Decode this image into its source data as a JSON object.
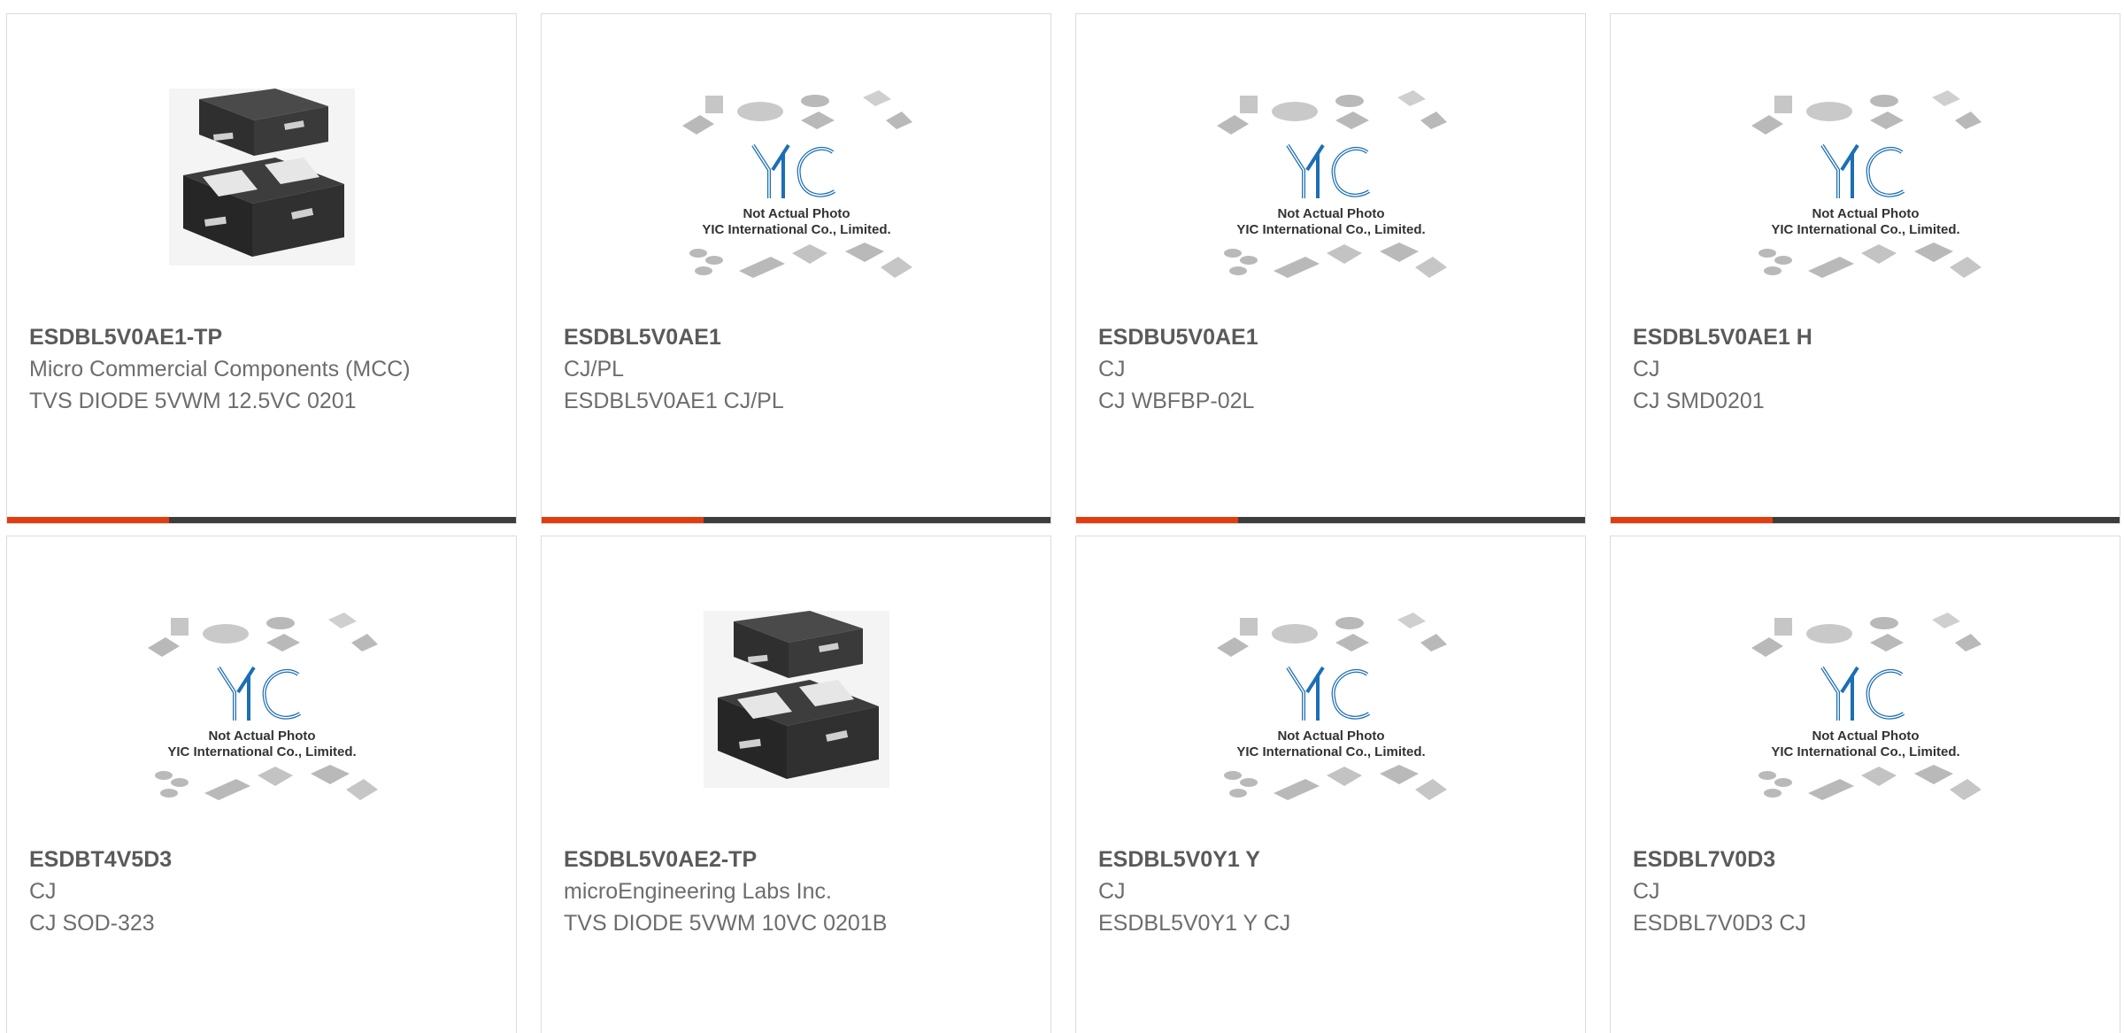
{
  "products": [
    {
      "part": "ESDBL5V0AE1-TP",
      "manufacturer": "Micro Commercial Components (MCC)",
      "description": "TVS DIODE 5VWM 12.5VC 0201",
      "image": "package-photo"
    },
    {
      "part": "ESDBL5V0AE1",
      "manufacturer": "CJ/PL",
      "description": "ESDBL5V0AE1 CJ/PL",
      "image": "yic-placeholder"
    },
    {
      "part": "ESDBU5V0AE1",
      "manufacturer": "CJ",
      "description": "CJ WBFBP-02L",
      "image": "yic-placeholder"
    },
    {
      "part": "ESDBL5V0AE1 H",
      "manufacturer": "CJ",
      "description": "CJ SMD0201",
      "image": "yic-placeholder"
    },
    {
      "part": "ESDBT4V5D3",
      "manufacturer": "CJ",
      "description": "CJ SOD-323",
      "image": "yic-placeholder"
    },
    {
      "part": "ESDBL5V0AE2-TP",
      "manufacturer": "microEngineering Labs Inc.",
      "description": "TVS DIODE 5VWM 10VC 0201B",
      "image": "package-photo"
    },
    {
      "part": "ESDBL5V0Y1 Y",
      "manufacturer": "CJ",
      "description": "ESDBL5V0Y1 Y CJ",
      "image": "yic-placeholder"
    },
    {
      "part": "ESDBL7V0D3",
      "manufacturer": "CJ",
      "description": "ESDBL7V0D3 CJ",
      "image": "yic-placeholder"
    }
  ],
  "placeholder": {
    "line1": "Not Actual Photo",
    "line2": "YIC International Co., Limited."
  },
  "colors": {
    "accent": "#e03e10",
    "bar": "#3d3d3d",
    "logo": "#1c6fb5"
  }
}
